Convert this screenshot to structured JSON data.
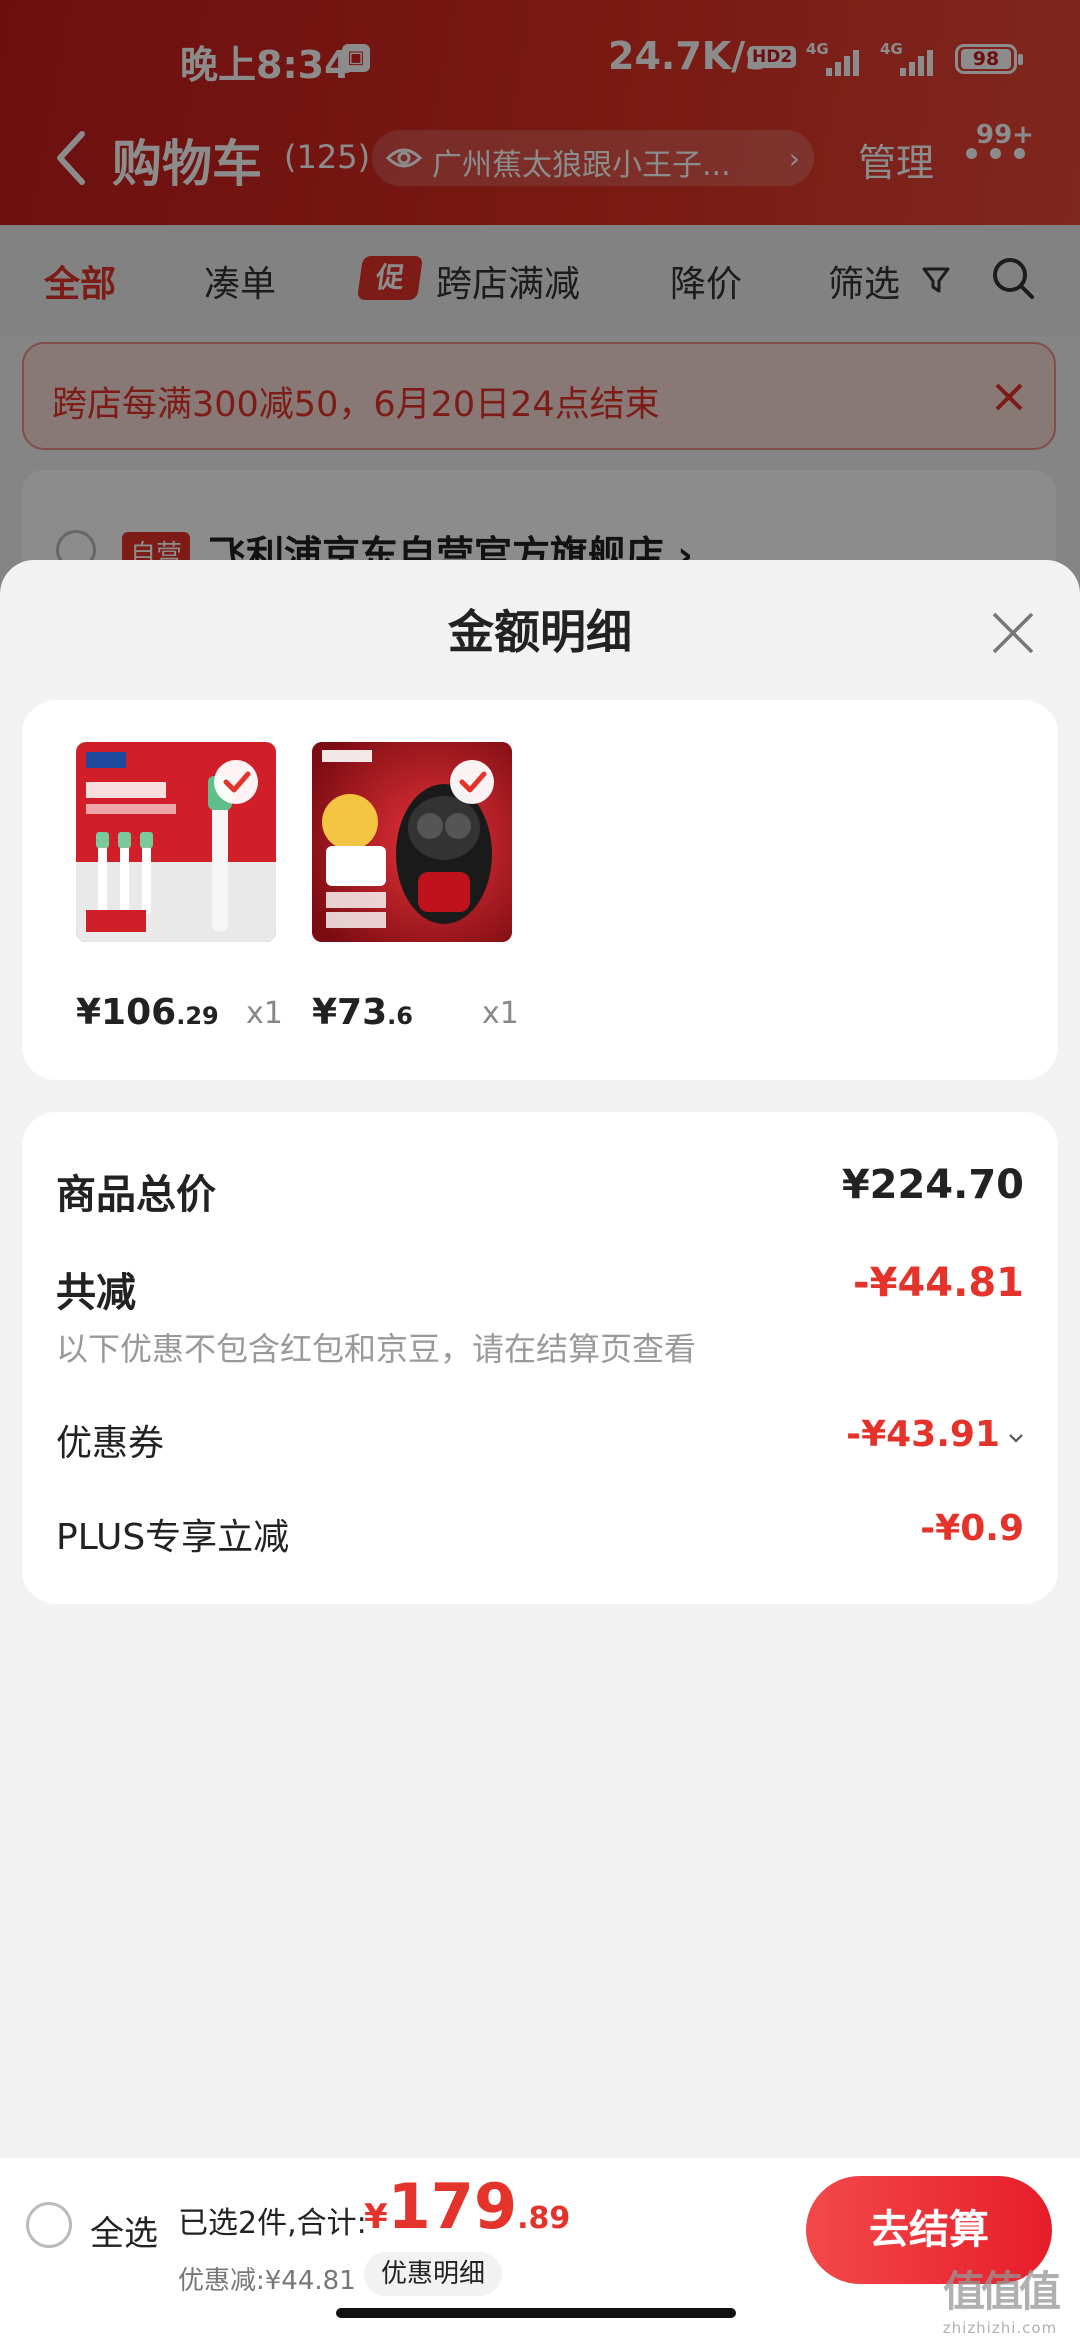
{
  "status_bar": {
    "time": "晚上8:34",
    "speed": "24.7K/s",
    "hd_label": "HD2",
    "net_1": "4G",
    "net_2": "4G",
    "battery": "98"
  },
  "nav": {
    "title": "购物车",
    "count": "(125)",
    "location": "广州蕉太狼跟小王子...",
    "manage": "管理",
    "message_badge": "99+"
  },
  "filter_tabs": [
    {
      "label": "全部",
      "active": true
    },
    {
      "label": "凑单"
    },
    {
      "label": "跨店满减",
      "tag": "促"
    },
    {
      "label": "降价"
    },
    {
      "label": "筛选"
    }
  ],
  "promo_banner": {
    "text": "跨店每满300减50，6月20日24点结束"
  },
  "store": {
    "tag": "自营",
    "name": "飞利浦京东自营官方旗舰店 ›"
  },
  "sheet": {
    "title": "金额明细",
    "items": [
      {
        "price_int": "¥106",
        "price_dec": ".29",
        "qty": "x1"
      },
      {
        "price_int": "¥73",
        "price_dec": ".6",
        "qty": "x1"
      }
    ],
    "summary": {
      "total_label": "商品总价",
      "total_value": "¥224.70",
      "discount_label": "共减",
      "discount_value": "-¥44.81",
      "note": "以下优惠不包含红包和京豆，请在结算页查看",
      "coupon_label": "优惠券",
      "coupon_value": "-¥43.91",
      "plus_label": "PLUS专享立减",
      "plus_value": "-¥0.9"
    }
  },
  "bottom_bar": {
    "select_all": "全选",
    "selected_text": "已选2件,合计:",
    "total_currency": "¥",
    "total_int": "179",
    "total_dec": ".89",
    "discount_text": "优惠减:¥44.81",
    "detail_chip": "优惠明细",
    "checkout": "去结算"
  },
  "watermark": {
    "glyphs": "值值值",
    "text": "zhizhizhi.com"
  },
  "colors": {
    "brand_red": "#e4332a",
    "header_red": "#c51d1d"
  }
}
